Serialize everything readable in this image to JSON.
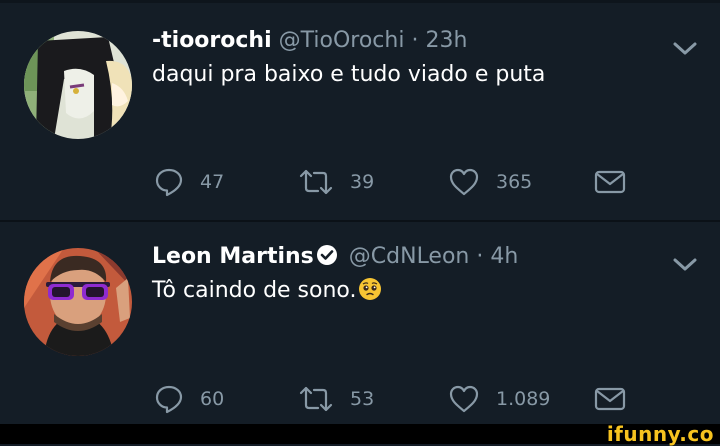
{
  "tweets": [
    {
      "name": "-tioorochi",
      "handle": "@TioOrochi",
      "separator": "·",
      "time": "23h",
      "text": "daqui pra baixo e tudo viado e puta",
      "verified": false,
      "replies": "47",
      "retweets": "39",
      "likes": "365",
      "avatar_icon": "anime-character-avatar"
    },
    {
      "name": "Leon Martins",
      "handle": "@CdNLeon",
      "separator": "·",
      "time": "4h",
      "text": "Tô caindo de sono.",
      "verified": true,
      "emoji_icon": "pleading-face-emoji",
      "replies": "60",
      "retweets": "53",
      "likes": "1.089",
      "avatar_icon": "man-with-purple-sunglasses-avatar"
    }
  ],
  "watermark": "ifunny.co",
  "colors": {
    "background": "#141d26",
    "secondary_text": "#8899a6",
    "primary_text": "#ffffff",
    "watermark": "#f7c31f"
  }
}
